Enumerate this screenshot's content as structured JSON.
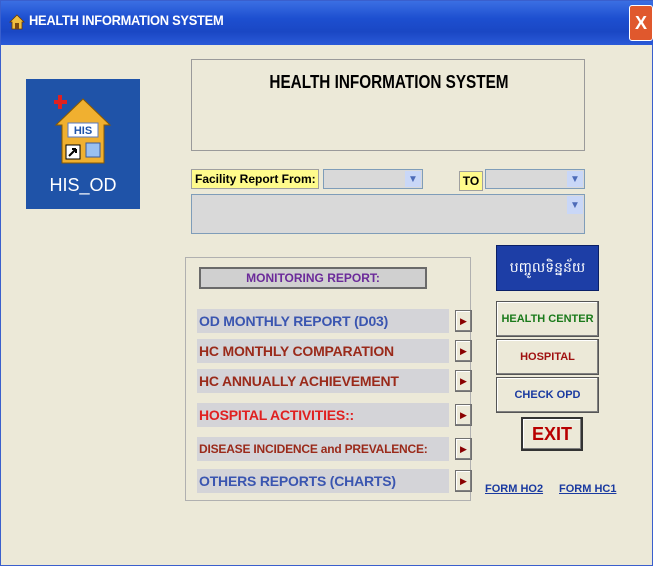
{
  "window": {
    "title": "HEALTH INFORMATION SYSTEM",
    "close_glyph": "X"
  },
  "desktop_icon": {
    "label": "HIS_OD",
    "badge_text": "HIS"
  },
  "header": {
    "title": "HEALTH INFORMATION SYSTEM"
  },
  "filters": {
    "from_label": "Facility Report From:",
    "from_value": "",
    "to_label": "TO",
    "to_value": "",
    "facility_value": ""
  },
  "monitoring": {
    "label": "MONITORING REPORT:",
    "reports": [
      {
        "label": "OD MONTHLY REPORT (D03)",
        "color": "#3a55b0"
      },
      {
        "label": "HC MONTHLY COMPARATION",
        "color": "#9a2a1a"
      },
      {
        "label": "HC ANNUALLY ACHIEVEMENT",
        "color": "#9a2a1a"
      },
      {
        "label": "HOSPITAL ACTIVITIES::",
        "color": "#e02020"
      },
      {
        "label": "DISEASE INCIDENCE and PREVALENCE:",
        "color": "#9a2a1a"
      },
      {
        "label": "OTHERS REPORTS (CHARTS)",
        "color": "#3a55b0"
      }
    ],
    "row_button_glyph": "▶"
  },
  "side_buttons": {
    "khmer_label": "បញ្ចូលទិន្នន័យ",
    "health_center": {
      "label": "HEALTH CENTER",
      "color": "#1a7a1a"
    },
    "hospital": {
      "label": "HOSPITAL",
      "color": "#a01010"
    },
    "check_opd": {
      "label": "CHECK OPD",
      "color": "#1a3aa0"
    },
    "exit": "EXIT"
  },
  "links": {
    "form_ho2": "FORM HO2",
    "form_hc1": "FORM HC1"
  }
}
